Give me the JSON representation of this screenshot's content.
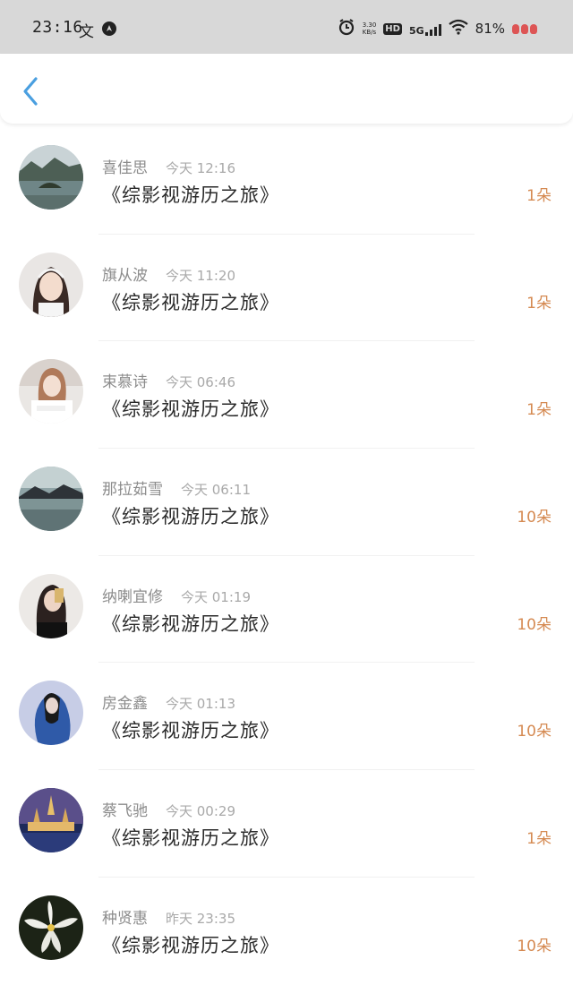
{
  "status_bar": {
    "time": "23:16",
    "speed": "3.30",
    "speed_unit": "KB/s",
    "hd": "HD",
    "network": "5G",
    "battery": "81%"
  },
  "header": {
    "back_icon": "chevron-left-icon"
  },
  "items": [
    {
      "name": "喜佳思",
      "time": "今天 12:16",
      "title": "《综影视游历之旅》",
      "count": "1朵"
    },
    {
      "name": "旗从波",
      "time": "今天 11:20",
      "title": "《综影视游历之旅》",
      "count": "1朵"
    },
    {
      "name": "束慕诗",
      "time": "今天 06:46",
      "title": "《综影视游历之旅》",
      "count": "1朵"
    },
    {
      "name": "那拉茹雪",
      "time": "今天 06:11",
      "title": "《综影视游历之旅》",
      "count": "10朵"
    },
    {
      "name": "纳喇宜修",
      "time": "今天 01:19",
      "title": "《综影视游历之旅》",
      "count": "10朵"
    },
    {
      "name": "房金鑫",
      "time": "今天 01:13",
      "title": "《综影视游历之旅》",
      "count": "10朵"
    },
    {
      "name": "蔡飞驰",
      "time": "今天 00:29",
      "title": "《综影视游历之旅》",
      "count": "1朵"
    },
    {
      "name": "种贤惠",
      "time": "昨天 23:35",
      "title": "《综影视游历之旅》",
      "count": "10朵"
    }
  ],
  "colors": {
    "accent": "#4a9fe0",
    "count": "#d58a52",
    "status_bar_bg": "#d8d8d8"
  }
}
